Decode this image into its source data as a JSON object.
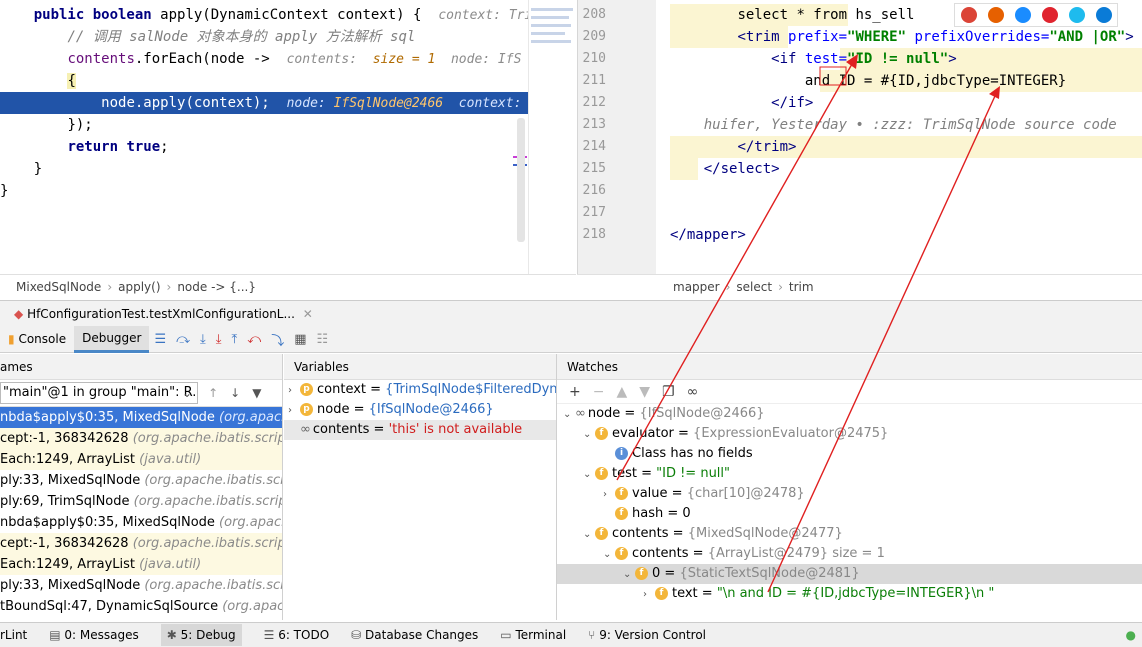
{
  "left_editor": {
    "lines": [
      {
        "indent": "    ",
        "tokens": [
          {
            "t": "public boolean ",
            "c": "kw"
          },
          {
            "t": "apply(DynamicContext context) {  ",
            "c": ""
          },
          {
            "t": "context: Tri",
            "c": "hint"
          }
        ]
      },
      {
        "indent": "        ",
        "tokens": [
          {
            "t": "// 调用 salNode 对象本身的 apply 方法解析 sql",
            "c": "cm"
          }
        ]
      },
      {
        "indent": "        ",
        "tokens": [
          {
            "t": "contents",
            "c": "fld"
          },
          {
            "t": ".forEach(node ->  ",
            "c": ""
          },
          {
            "t": "contents:  ",
            "c": "hint"
          },
          {
            "t": "size = 1  ",
            "c": "hintv"
          },
          {
            "t": "node: IfS",
            "c": "hint"
          }
        ]
      },
      {
        "indent": "        ",
        "tokens": [
          {
            "t": "{",
            "c": "brace-hl"
          }
        ]
      },
      {
        "indent": "            ",
        "tokens": [
          {
            "t": "node.apply(context);  ",
            "c": ""
          },
          {
            "t": "node: ",
            "c": "hint"
          },
          {
            "t": "IfSqlNode@2466  ",
            "c": "hintv"
          },
          {
            "t": "context:",
            "c": "hint"
          }
        ]
      },
      {
        "indent": "        ",
        "tokens": [
          {
            "t": "});",
            "c": ""
          }
        ]
      },
      {
        "indent": "        ",
        "tokens": [
          {
            "t": "return true",
            "c": "kw"
          },
          {
            "t": ";",
            "c": ""
          }
        ]
      },
      {
        "indent": "    ",
        "tokens": [
          {
            "t": "}",
            "c": ""
          }
        ]
      },
      {
        "indent": "",
        "tokens": [
          {
            "t": "}",
            "c": ""
          }
        ]
      }
    ],
    "breadcrumb": [
      "MixedSqlNode",
      "apply()",
      "node -> {...}"
    ]
  },
  "right_editor": {
    "line_numbers": [
      "208",
      "209",
      "210",
      "211",
      "212",
      "213",
      "214",
      "215",
      "216",
      "217",
      "218"
    ],
    "lines": [
      {
        "indent": "        ",
        "tokens": [
          {
            "t": "select * from hs_sell",
            "c": ""
          }
        ]
      },
      {
        "indent": "        ",
        "tokens": [
          {
            "t": "<trim ",
            "c": "xt"
          },
          {
            "t": "prefix=",
            "c": "xa"
          },
          {
            "t": "\"WHERE\" ",
            "c": "xv"
          },
          {
            "t": "prefixOverrides=",
            "c": "xa"
          },
          {
            "t": "\"AND |OR\"",
            "c": "xv"
          },
          {
            "t": ">",
            "c": "xt"
          }
        ]
      },
      {
        "indent": "            ",
        "tokens": [
          {
            "t": "<if ",
            "c": "xt"
          },
          {
            "t": "test=",
            "c": "xa"
          },
          {
            "t": "\"ID != null\"",
            "c": "xv"
          },
          {
            "t": ">",
            "c": "xt"
          }
        ]
      },
      {
        "indent": "                ",
        "tokens": [
          {
            "t": "and ID = #{ID,jdbcType=INTEGER}",
            "c": ""
          }
        ]
      },
      {
        "indent": "            ",
        "tokens": [
          {
            "t": "</if>",
            "c": "xt"
          }
        ]
      },
      {
        "indent": "    ",
        "tokens": [
          {
            "t": "huifer, Yesterday • :zzz: TrimSqlNode source code",
            "c": "cm"
          }
        ]
      },
      {
        "indent": "        ",
        "tokens": [
          {
            "t": "</trim>",
            "c": "xt"
          }
        ]
      },
      {
        "indent": "    ",
        "tokens": [
          {
            "t": "</select>",
            "c": "xt"
          }
        ]
      },
      {
        "indent": "",
        "tokens": []
      },
      {
        "indent": "",
        "tokens": []
      },
      {
        "indent": "",
        "tokens": [
          {
            "t": "</mapper>",
            "c": "xt"
          }
        ]
      }
    ],
    "breadcrumb": [
      "mapper",
      "select",
      "trim"
    ]
  },
  "browser_icons": [
    {
      "name": "chrome-icon",
      "color": "#db4437"
    },
    {
      "name": "firefox-icon",
      "color": "#e66000"
    },
    {
      "name": "safari-icon",
      "color": "#1a8cff"
    },
    {
      "name": "opera-icon",
      "color": "#e0242f"
    },
    {
      "name": "ie-icon",
      "color": "#1ebbee"
    },
    {
      "name": "edge-icon",
      "color": "#0a7bd7"
    }
  ],
  "debug": {
    "session_tab": "HfConfigurationTest.testXmlConfigurationL...",
    "tabs": {
      "console": "Console",
      "debugger": "Debugger"
    },
    "frames_title": "ames",
    "variables_title": "Variables",
    "watches_title": "Watches",
    "thread": "\"main\"@1 in group \"main\": R...",
    "frames": [
      {
        "main": "nbda$apply$0:35, MixedSqlNode ",
        "pkg": "(org.apache.ib",
        "style": "sel"
      },
      {
        "main": "cept:-1, 368342628 ",
        "pkg": "(org.apache.ibatis.scripting.x",
        "style": "lib"
      },
      {
        "main": "Each:1249, ArrayList ",
        "pkg": "(java.util)",
        "style": "lib"
      },
      {
        "main": "ply:33, MixedSqlNode ",
        "pkg": "(org.apache.ibatis.scripting",
        "style": ""
      },
      {
        "main": "ply:69, TrimSqlNode ",
        "pkg": "(org.apache.ibatis.scripting.",
        "style": ""
      },
      {
        "main": "nbda$apply$0:35, MixedSqlNode ",
        "pkg": "(org.apache.iba",
        "style": ""
      },
      {
        "main": "cept:-1, 368342628 ",
        "pkg": "(org.apache.ibatis.scripting.x",
        "style": "lib"
      },
      {
        "main": "Each:1249, ArrayList ",
        "pkg": "(java.util)",
        "style": "lib"
      },
      {
        "main": "ply:33, MixedSqlNode ",
        "pkg": "(org.apache.ibatis.scripting",
        "style": ""
      },
      {
        "main": "tBoundSql:47, DynamicSqlSource ",
        "pkg": "(org.apache.iba",
        "style": ""
      }
    ],
    "variables": [
      {
        "name": "context",
        "value": "{TrimSqlNode$FilteredDynami",
        "icon": "p",
        "expand": true
      },
      {
        "name": "node",
        "value": "{IfSqlNode@2466}",
        "icon": "p",
        "expand": true
      },
      {
        "name": "contents",
        "value": "'this' is not available",
        "icon": "oo",
        "expand": false,
        "error": true
      }
    ],
    "watches": [
      {
        "level": 0,
        "tri": "v",
        "icon": "oo",
        "name": "node",
        "value": "{IfSqlNode@2466}"
      },
      {
        "level": 1,
        "tri": "v",
        "icon": "f",
        "name": "evaluator",
        "value": "{ExpressionEvaluator@2475}"
      },
      {
        "level": 2,
        "tri": "",
        "icon": "i",
        "name": "",
        "value": "Class has no fields",
        "plain": true
      },
      {
        "level": 1,
        "tri": "v",
        "icon": "f",
        "name": "test",
        "value": "\"ID != null\"",
        "str": true
      },
      {
        "level": 2,
        "tri": ">",
        "icon": "f",
        "name": "value",
        "value": "{char[10]@2478}"
      },
      {
        "level": 2,
        "tri": "",
        "icon": "f",
        "name": "hash",
        "value": "0",
        "num": true
      },
      {
        "level": 1,
        "tri": "v",
        "icon": "f",
        "name": "contents",
        "value": "{MixedSqlNode@2477}"
      },
      {
        "level": 2,
        "tri": "v",
        "icon": "f",
        "name": "contents",
        "value": "{ArrayList@2479}  size = 1"
      },
      {
        "level": 3,
        "tri": "v",
        "icon": "f",
        "name": "0",
        "value": "{StaticTextSqlNode@2481}",
        "sel": true
      },
      {
        "level": 4,
        "tri": ">",
        "icon": "f",
        "name": "text",
        "value": "\"\\n              and ID = #{ID,jdbcType=INTEGER}\\n          \"",
        "str": true
      }
    ]
  },
  "statusbar": [
    {
      "label": "rLint",
      "icon": ""
    },
    {
      "label": "0: Messages",
      "icon": "msg"
    },
    {
      "label": "5: Debug",
      "icon": "bug",
      "active": true
    },
    {
      "label": "6: TODO",
      "icon": "list"
    },
    {
      "label": "Database Changes",
      "icon": "db"
    },
    {
      "label": "Terminal",
      "icon": "term"
    },
    {
      "label": "9: Version Control",
      "icon": "vc"
    }
  ]
}
